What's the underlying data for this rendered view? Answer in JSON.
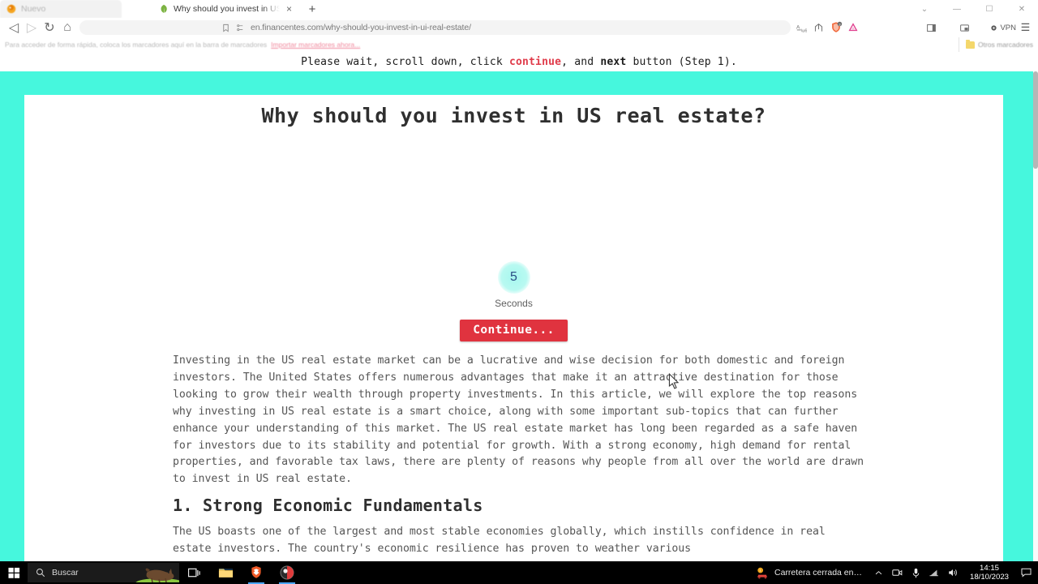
{
  "browser": {
    "tabs": [
      {
        "title": "Nuevo",
        "favicon": "firefox-icon",
        "active": false
      },
      {
        "title": "Why should you invest in US re",
        "favicon": "leaf-icon",
        "active": true
      }
    ],
    "new_tab_label": "+",
    "close_tab_label": "×",
    "window_controls": [
      {
        "name": "tab-search",
        "glyph": "⌄"
      },
      {
        "name": "minimize",
        "glyph": "—"
      },
      {
        "name": "maximize",
        "glyph": "☐"
      },
      {
        "name": "close",
        "glyph": "✕"
      }
    ],
    "nav": {
      "back": "◁",
      "forward": "▷",
      "reload": "↻",
      "home": "⌂"
    },
    "url": "en.financentes.com/why-should-you-invest-in-ui-real-estate/",
    "toolbar_icons": [
      "translate-icon",
      "share-icon",
      "brave-shield-icon",
      "brave-rewards-triangle-icon",
      "sidebar-icon",
      "picture-in-picture-icon"
    ],
    "vpn_label": "VPN",
    "menu_label": "☰",
    "bookmarks": {
      "message": "Para acceder de forma rápida, coloca los marcadores aquí en la barra de marcadores",
      "link": "Importar marcadores ahora...",
      "other_folder": "Otros marcadores"
    }
  },
  "instruction": {
    "part1": "Please wait, scroll down, click ",
    "highlight_continue": "continue",
    "part2": ", and ",
    "highlight_next": "next",
    "part3": " button (Step 1)."
  },
  "page": {
    "title": "Why should you invest in US real estate?",
    "countdown": {
      "value": "5",
      "unit_label": "Seconds",
      "button_label": "Continue..."
    },
    "intro_paragraph": "Investing in the US real estate market can be a lucrative and wise decision for both domestic and foreign investors. The United States offers numerous advantages that make it an attractive destination for those looking to grow their wealth through property investments. In this article, we will explore the top reasons why investing in US real estate is a smart choice, along with some important sub-topics that can further enhance your understanding of this market. The US real estate market has long been regarded as a safe haven for investors due to its stability and potential for growth. With a strong economy, high demand for rental properties, and favorable tax laws, there are plenty of reasons why people from all over the world are drawn to invest in US real estate.",
    "section_heading": "1. Strong Economic Fundamentals",
    "section_paragraph": "The US boasts one of the largest and most stable economies globally, which instills confidence in real estate investors. The country's economic resilience has proven to weather various"
  },
  "colors": {
    "page_background_cyan": "#46f7dd",
    "continue_button_red": "#e0333f",
    "highlight_red": "#e03b4a",
    "countdown_text_blue": "#2b4c84"
  },
  "taskbar": {
    "start_label": "start-icon",
    "search_placeholder": "Buscar",
    "apps": [
      {
        "name": "task-view-icon"
      },
      {
        "name": "file-explorer-icon"
      },
      {
        "name": "brave-browser-icon"
      },
      {
        "name": "screen-recorder-icon"
      }
    ],
    "notification_text": "Carretera cerrada en…",
    "tray_icons": [
      "chevron-up-icon",
      "camera-icon",
      "microphone-icon",
      "network-icon",
      "volume-icon"
    ],
    "time": "14:15",
    "date": "18/10/2023",
    "action_center_label": "action-center-icon"
  }
}
